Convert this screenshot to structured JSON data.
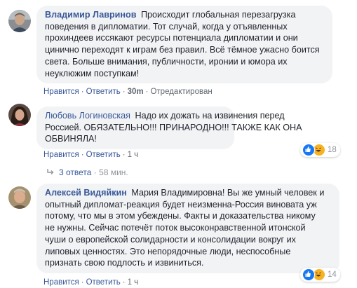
{
  "comments": [
    {
      "author": "Владимир Лавринов",
      "lines": [
        "Происходит глобальная перезагрузка",
        "поведения в дипломатии. Тот случай, когда у отъявленных",
        "прохиндеев иссякают ресурсы потенциала дипломатии и они",
        "цинично переходят к играм без правил. Всё тёмное ужасно боится",
        "света. Больше внимания, публичности, иронии и юмора их",
        "неуклюжим поступкам!"
      ],
      "actions": {
        "like": "Нравится",
        "reply": "Ответить",
        "time": "30m",
        "edited": "Отредактирован"
      }
    },
    {
      "author": "Любовь Логиновская",
      "lines": [
        "Надо их дожать на извинения перед",
        "Россией. ОБЯЗАТЕЛЬНО!!! ПРИНАРОДНО!!! ТАКЖЕ КАК ОНА",
        "ОБВИНЯЛА!"
      ],
      "actions": {
        "like": "Нравится",
        "reply": "Ответить",
        "time": "1 ч"
      },
      "reactions": {
        "count": "18",
        "icons": [
          "like-icon",
          "haha-icon"
        ]
      },
      "replies": {
        "label": "3 ответа",
        "time": "58 мин."
      }
    },
    {
      "author": "Алексей Видяйкин",
      "lines": [
        "Мария Владимировна! Вы же умный человек и",
        "опытный дипломат-реакция будет неизменна-Россия виновата уж",
        "потому, что мы в этом убеждены. Факты и доказательства никому",
        "не нужны. Сейчас потечёт поток высоконравственной итонской",
        "чуши о европейской солидарности и консолидации вокруг их",
        "липовых ценностях. Это непорядочные люди, неспособные",
        "признать свою подлость и извиниться."
      ],
      "actions": {
        "like": "Нравится",
        "reply": "Ответить",
        "time": "1 ч"
      },
      "reactions": {
        "count": "14",
        "icons": [
          "like-icon",
          "haha-icon"
        ]
      }
    }
  ],
  "colors": {
    "author": "#385898",
    "bubble": "#f2f3f5",
    "like": "#1877f2",
    "haha": "#f7b125"
  }
}
